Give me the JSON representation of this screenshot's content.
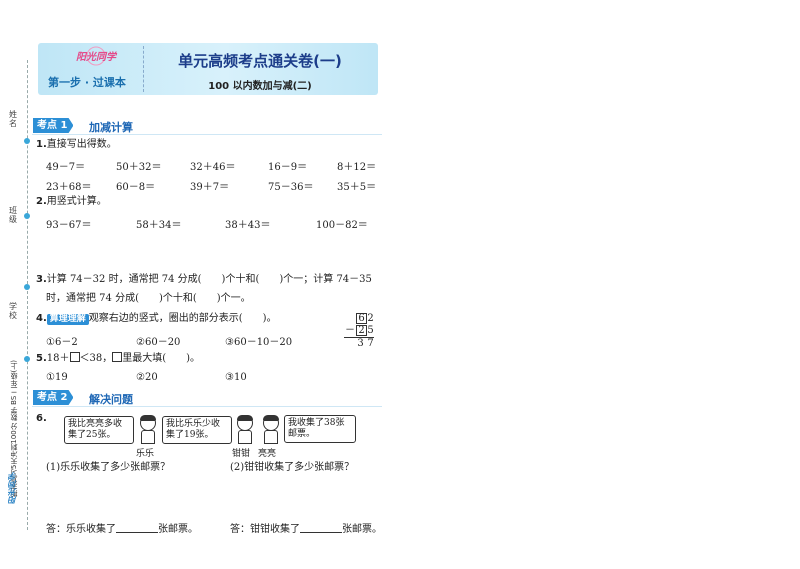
{
  "binding": {
    "labels": [
      "姓名",
      "班级",
      "学校"
    ],
    "spine": "期末复习5天冲刺100分 数学 BS 二年级(上)",
    "brand": "阳光同学"
  },
  "header": {
    "logo": "阳光同学",
    "step": "第一步 · 过课本",
    "title": "单元高频考点通关卷(一)",
    "subtitle": "100 以内数加与减(二)"
  },
  "section1": {
    "tag": "考点 1",
    "title": "加减计算",
    "q1": {
      "num": "1.",
      "text": "直接写出得数。",
      "row1": [
        "49－7＝",
        "50＋32＝",
        "32＋46＝",
        "16－9＝",
        "8＋12＝"
      ],
      "row2": [
        "23＋68＝",
        "60－8＝",
        "39＋7＝",
        "75－36＝",
        "35＋5＝"
      ]
    },
    "q2": {
      "num": "2.",
      "text": "用竖式计算。",
      "items": [
        "93－67＝",
        "58＋34＝",
        "38＋43＝",
        "100－82＝"
      ]
    },
    "q3": {
      "num": "3.",
      "line1": "计算 74－32 时，通常把 74 分成(　　)个十和(　　)个一；计算 74－35",
      "line2": "时，通常把 74 分成(　　)个十和(　　)个一。"
    },
    "q4": {
      "num": "4.",
      "badge": "算理理解",
      "text": "观察右边的竖式，圈出的部分表示(　　)。",
      "options": [
        "①6－2",
        "②60－20",
        "③60－10－20"
      ],
      "vcalc": {
        "top": [
          "6",
          "2"
        ],
        "op": "－",
        "mid": [
          "2",
          "5"
        ],
        "result": [
          "3",
          "7"
        ]
      }
    },
    "q5": {
      "num": "5.",
      "pre": "18＋",
      "post": "＜38，",
      "post2": "里最大填(　　)。",
      "options": [
        "①19",
        "②20",
        "③10"
      ]
    }
  },
  "section2": {
    "tag": "考点 2",
    "title": "解决问题",
    "q6": {
      "num": "6.",
      "bubbles": [
        "我比亮亮多收集了25张。",
        "我比乐乐少收集了19张。",
        "我收集了38张邮票。"
      ],
      "kids": [
        "乐乐",
        "钳钳",
        "亮亮"
      ],
      "sub1": "(1)乐乐收集了多少张邮票？",
      "sub2": "(2)钳钳收集了多少张邮票？",
      "ans1_pre": "答：乐乐收集了",
      "ans1_post": "张邮票。",
      "ans2_pre": "答：钳钳收集了",
      "ans2_post": "张邮票。"
    }
  }
}
